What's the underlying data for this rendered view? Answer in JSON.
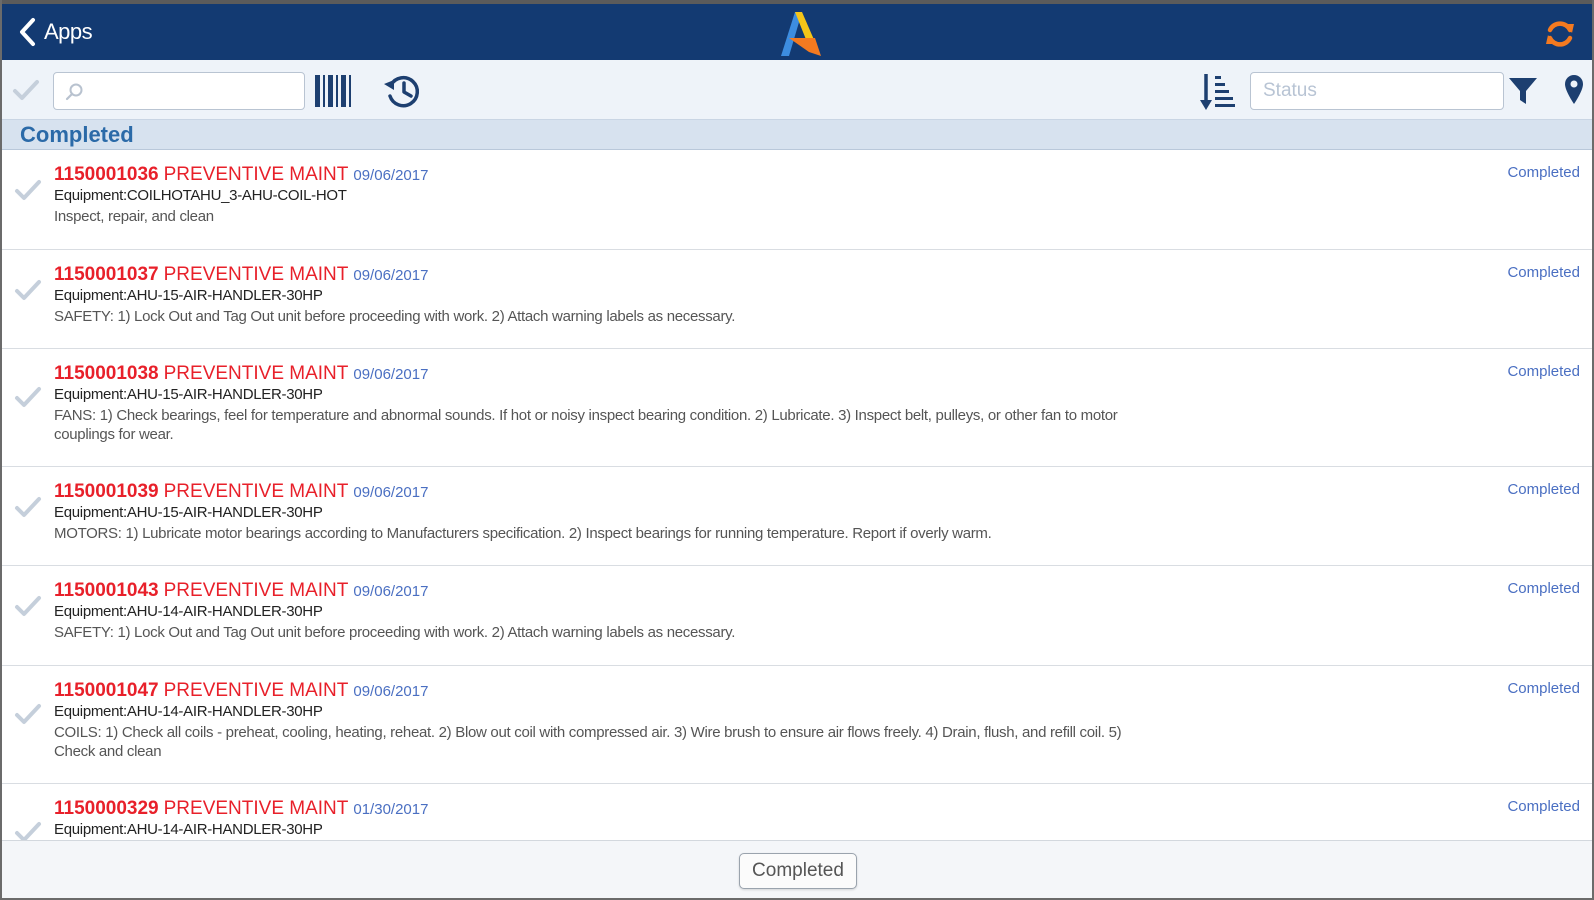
{
  "header": {
    "back_label": "Apps",
    "logo_icon": "app-logo-icon",
    "refresh_icon": "refresh-icon",
    "colors": {
      "bar": "#133a72",
      "accent": "#f47a20"
    }
  },
  "toolbar": {
    "search": {
      "value": "",
      "placeholder": ""
    },
    "status_filter": {
      "value": "",
      "placeholder": "Status"
    }
  },
  "section": {
    "title": "Completed"
  },
  "work_orders": [
    {
      "number": "1150001036",
      "type": "PREVENTIVE MAINT",
      "date": "09/06/2017",
      "equipment": "Equipment:COILHOTAHU_3-AHU-COIL-HOT",
      "description": "Inspect, repair, and clean",
      "status": "Completed"
    },
    {
      "number": "1150001037",
      "type": "PREVENTIVE MAINT",
      "date": "09/06/2017",
      "equipment": "Equipment:AHU-15-AIR-HANDLER-30HP",
      "description": "SAFETY: 1) Lock Out and Tag Out unit before proceeding with work. 2) Attach warning labels as necessary.",
      "status": "Completed"
    },
    {
      "number": "1150001038",
      "type": "PREVENTIVE MAINT",
      "date": "09/06/2017",
      "equipment": "Equipment:AHU-15-AIR-HANDLER-30HP",
      "description": "FANS: 1) Check bearings, feel for temperature and abnormal sounds. If hot or noisy inspect bearing condition. 2) Lubricate. 3) Inspect belt, pulleys, or other fan to motor couplings for wear.",
      "status": "Completed"
    },
    {
      "number": "1150001039",
      "type": "PREVENTIVE MAINT",
      "date": "09/06/2017",
      "equipment": "Equipment:AHU-15-AIR-HANDLER-30HP",
      "description": "MOTORS: 1) Lubricate motor bearings according to Manufacturers specification. 2) Inspect bearings for running temperature. Report if overly warm.",
      "status": "Completed"
    },
    {
      "number": "1150001043",
      "type": "PREVENTIVE MAINT",
      "date": "09/06/2017",
      "equipment": "Equipment:AHU-14-AIR-HANDLER-30HP",
      "description": "SAFETY: 1) Lock Out and Tag Out unit before proceeding with work. 2) Attach warning labels as necessary.",
      "status": "Completed"
    },
    {
      "number": "1150001047",
      "type": "PREVENTIVE MAINT",
      "date": "09/06/2017",
      "equipment": "Equipment:AHU-14-AIR-HANDLER-30HP",
      "description": "COILS: 1) Check all coils - preheat, cooling, heating, reheat. 2) Blow out coil with compressed air. 3) Wire brush to ensure air flows freely. 4) Drain, flush, and refill coil. 5) Check and clean",
      "status": "Completed"
    },
    {
      "number": "1150000329",
      "type": "PREVENTIVE MAINT",
      "date": "01/30/2017",
      "equipment": "Equipment:AHU-14-AIR-HANDLER-30HP",
      "description": "",
      "status": "Completed"
    }
  ],
  "footer": {
    "button_label": "Completed"
  }
}
